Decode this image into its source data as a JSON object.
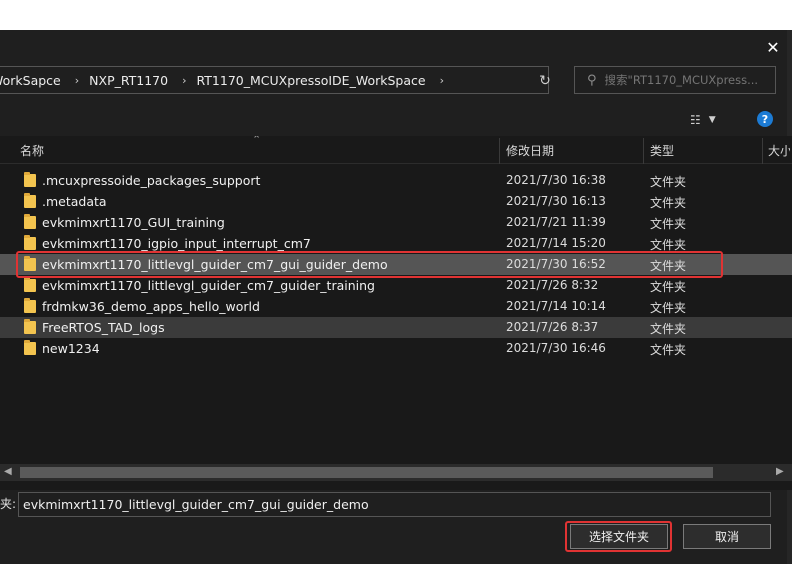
{
  "breadcrumbs": [
    "WorkSapce",
    "NXP_RT1170",
    "RT1170_MCUXpressoIDE_WorkSpace"
  ],
  "search": {
    "placeholder": "搜索\"RT1170_MCUXpress..."
  },
  "columns": {
    "name": "名称",
    "date": "修改日期",
    "type": "类型",
    "size": "大小"
  },
  "files": [
    {
      "name": ".mcuxpressoide_packages_support",
      "date": "2021/7/30 16:38",
      "type": "文件夹"
    },
    {
      "name": ".metadata",
      "date": "2021/7/30 16:13",
      "type": "文件夹"
    },
    {
      "name": "evkmimxrt1170_GUI_training",
      "date": "2021/7/21 11:39",
      "type": "文件夹"
    },
    {
      "name": "evkmimxrt1170_igpio_input_interrupt_cm7",
      "date": "2021/7/14 15:20",
      "type": "文件夹"
    },
    {
      "name": "evkmimxrt1170_littlevgl_guider_cm7_gui_guider_demo",
      "date": "2021/7/30 16:52",
      "type": "文件夹"
    },
    {
      "name": "evkmimxrt1170_littlevgl_guider_cm7_guider_training",
      "date": "2021/7/26 8:32",
      "type": "文件夹"
    },
    {
      "name": "frdmkw36_demo_apps_hello_world",
      "date": "2021/7/14 10:14",
      "type": "文件夹"
    },
    {
      "name": "FreeRTOS_TAD_logs",
      "date": "2021/7/26 8:37",
      "type": "文件夹"
    },
    {
      "name": "new1234",
      "date": "2021/7/30 16:46",
      "type": "文件夹"
    }
  ],
  "bottom": {
    "folder_label": "夹:",
    "folder_value": "evkmimxrt1170_littlevgl_guider_cm7_gui_guider_demo",
    "select_label": "选择文件夹",
    "cancel_label": "取消"
  },
  "icons": {
    "close": "close-icon",
    "refresh": "refresh-icon",
    "search": "search-icon",
    "view": "view-details-icon",
    "help": "help-icon",
    "folder": "folder-icon"
  },
  "colors": {
    "folder": "#f3c44f",
    "highlight": "#e03333",
    "help": "#1c7bd4"
  }
}
